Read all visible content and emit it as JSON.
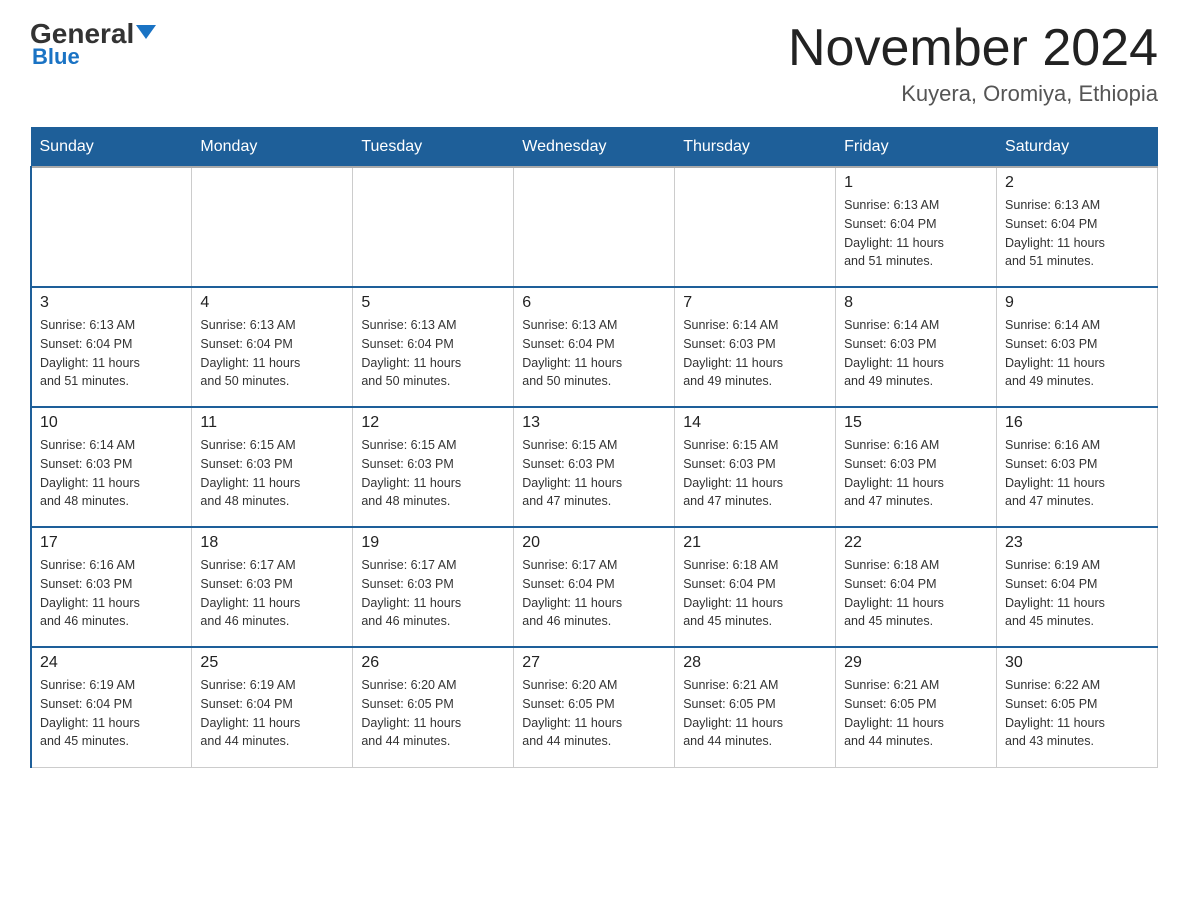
{
  "header": {
    "logo_text_general": "General",
    "logo_text_blue": "Blue",
    "month_title": "November 2024",
    "location": "Kuyera, Oromiya, Ethiopia"
  },
  "weekdays": [
    "Sunday",
    "Monday",
    "Tuesday",
    "Wednesday",
    "Thursday",
    "Friday",
    "Saturday"
  ],
  "weeks": [
    [
      {
        "day": "",
        "info": ""
      },
      {
        "day": "",
        "info": ""
      },
      {
        "day": "",
        "info": ""
      },
      {
        "day": "",
        "info": ""
      },
      {
        "day": "",
        "info": ""
      },
      {
        "day": "1",
        "info": "Sunrise: 6:13 AM\nSunset: 6:04 PM\nDaylight: 11 hours\nand 51 minutes."
      },
      {
        "day": "2",
        "info": "Sunrise: 6:13 AM\nSunset: 6:04 PM\nDaylight: 11 hours\nand 51 minutes."
      }
    ],
    [
      {
        "day": "3",
        "info": "Sunrise: 6:13 AM\nSunset: 6:04 PM\nDaylight: 11 hours\nand 51 minutes."
      },
      {
        "day": "4",
        "info": "Sunrise: 6:13 AM\nSunset: 6:04 PM\nDaylight: 11 hours\nand 50 minutes."
      },
      {
        "day": "5",
        "info": "Sunrise: 6:13 AM\nSunset: 6:04 PM\nDaylight: 11 hours\nand 50 minutes."
      },
      {
        "day": "6",
        "info": "Sunrise: 6:13 AM\nSunset: 6:04 PM\nDaylight: 11 hours\nand 50 minutes."
      },
      {
        "day": "7",
        "info": "Sunrise: 6:14 AM\nSunset: 6:03 PM\nDaylight: 11 hours\nand 49 minutes."
      },
      {
        "day": "8",
        "info": "Sunrise: 6:14 AM\nSunset: 6:03 PM\nDaylight: 11 hours\nand 49 minutes."
      },
      {
        "day": "9",
        "info": "Sunrise: 6:14 AM\nSunset: 6:03 PM\nDaylight: 11 hours\nand 49 minutes."
      }
    ],
    [
      {
        "day": "10",
        "info": "Sunrise: 6:14 AM\nSunset: 6:03 PM\nDaylight: 11 hours\nand 48 minutes."
      },
      {
        "day": "11",
        "info": "Sunrise: 6:15 AM\nSunset: 6:03 PM\nDaylight: 11 hours\nand 48 minutes."
      },
      {
        "day": "12",
        "info": "Sunrise: 6:15 AM\nSunset: 6:03 PM\nDaylight: 11 hours\nand 48 minutes."
      },
      {
        "day": "13",
        "info": "Sunrise: 6:15 AM\nSunset: 6:03 PM\nDaylight: 11 hours\nand 47 minutes."
      },
      {
        "day": "14",
        "info": "Sunrise: 6:15 AM\nSunset: 6:03 PM\nDaylight: 11 hours\nand 47 minutes."
      },
      {
        "day": "15",
        "info": "Sunrise: 6:16 AM\nSunset: 6:03 PM\nDaylight: 11 hours\nand 47 minutes."
      },
      {
        "day": "16",
        "info": "Sunrise: 6:16 AM\nSunset: 6:03 PM\nDaylight: 11 hours\nand 47 minutes."
      }
    ],
    [
      {
        "day": "17",
        "info": "Sunrise: 6:16 AM\nSunset: 6:03 PM\nDaylight: 11 hours\nand 46 minutes."
      },
      {
        "day": "18",
        "info": "Sunrise: 6:17 AM\nSunset: 6:03 PM\nDaylight: 11 hours\nand 46 minutes."
      },
      {
        "day": "19",
        "info": "Sunrise: 6:17 AM\nSunset: 6:03 PM\nDaylight: 11 hours\nand 46 minutes."
      },
      {
        "day": "20",
        "info": "Sunrise: 6:17 AM\nSunset: 6:04 PM\nDaylight: 11 hours\nand 46 minutes."
      },
      {
        "day": "21",
        "info": "Sunrise: 6:18 AM\nSunset: 6:04 PM\nDaylight: 11 hours\nand 45 minutes."
      },
      {
        "day": "22",
        "info": "Sunrise: 6:18 AM\nSunset: 6:04 PM\nDaylight: 11 hours\nand 45 minutes."
      },
      {
        "day": "23",
        "info": "Sunrise: 6:19 AM\nSunset: 6:04 PM\nDaylight: 11 hours\nand 45 minutes."
      }
    ],
    [
      {
        "day": "24",
        "info": "Sunrise: 6:19 AM\nSunset: 6:04 PM\nDaylight: 11 hours\nand 45 minutes."
      },
      {
        "day": "25",
        "info": "Sunrise: 6:19 AM\nSunset: 6:04 PM\nDaylight: 11 hours\nand 44 minutes."
      },
      {
        "day": "26",
        "info": "Sunrise: 6:20 AM\nSunset: 6:05 PM\nDaylight: 11 hours\nand 44 minutes."
      },
      {
        "day": "27",
        "info": "Sunrise: 6:20 AM\nSunset: 6:05 PM\nDaylight: 11 hours\nand 44 minutes."
      },
      {
        "day": "28",
        "info": "Sunrise: 6:21 AM\nSunset: 6:05 PM\nDaylight: 11 hours\nand 44 minutes."
      },
      {
        "day": "29",
        "info": "Sunrise: 6:21 AM\nSunset: 6:05 PM\nDaylight: 11 hours\nand 44 minutes."
      },
      {
        "day": "30",
        "info": "Sunrise: 6:22 AM\nSunset: 6:05 PM\nDaylight: 11 hours\nand 43 minutes."
      }
    ]
  ]
}
